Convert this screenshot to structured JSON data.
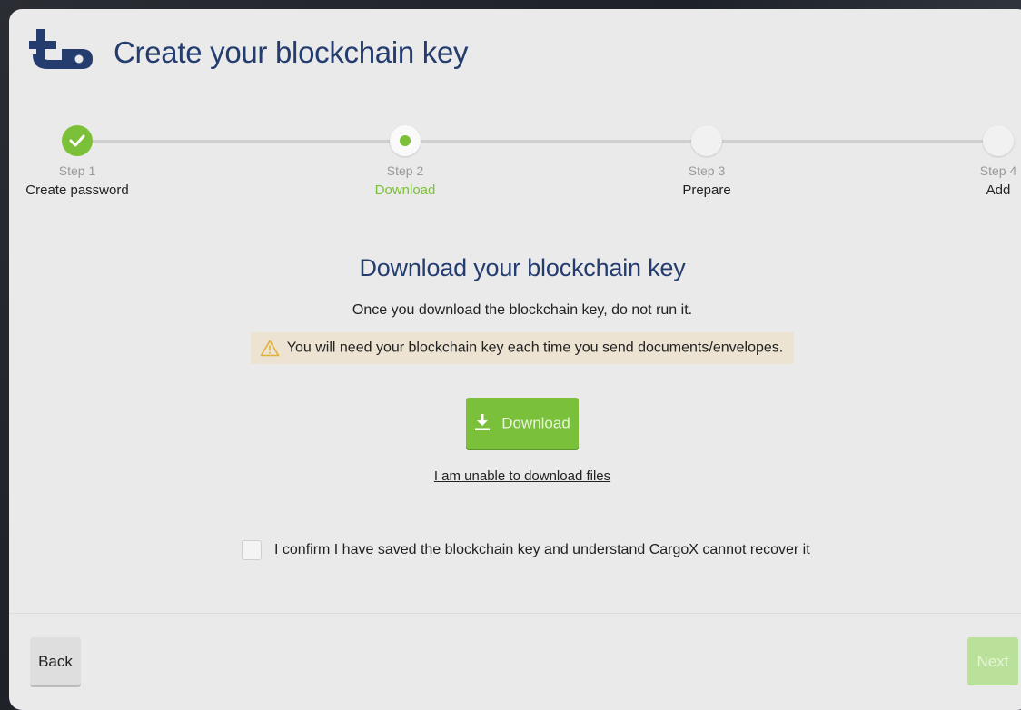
{
  "header": {
    "title": "Create your blockchain key",
    "logo_icon": "key-plus-logo-icon"
  },
  "stepper": {
    "steps": [
      {
        "number": "Step 1",
        "name": "Create password",
        "state": "done"
      },
      {
        "number": "Step 2",
        "name": "Download",
        "state": "active"
      },
      {
        "number": "Step 3",
        "name": "Prepare",
        "state": "pending"
      },
      {
        "number": "Step 4",
        "name": "Add",
        "state": "pending"
      }
    ]
  },
  "main": {
    "title": "Download your blockchain key",
    "instruction": "Once you download the blockchain key, do not run it.",
    "warning": "You will need your blockchain key each time you send documents/envelopes.",
    "download_label": "Download",
    "unable_link": "I am unable to download files",
    "confirm_label": "I confirm I have saved the blockchain key and understand CargoX cannot recover it",
    "confirm_checked": false
  },
  "footer": {
    "back_label": "Back",
    "next_label": "Next"
  },
  "colors": {
    "accent_green": "#7cc03a",
    "title_blue": "#243d6e",
    "warning_bg": "#ece3d2"
  }
}
